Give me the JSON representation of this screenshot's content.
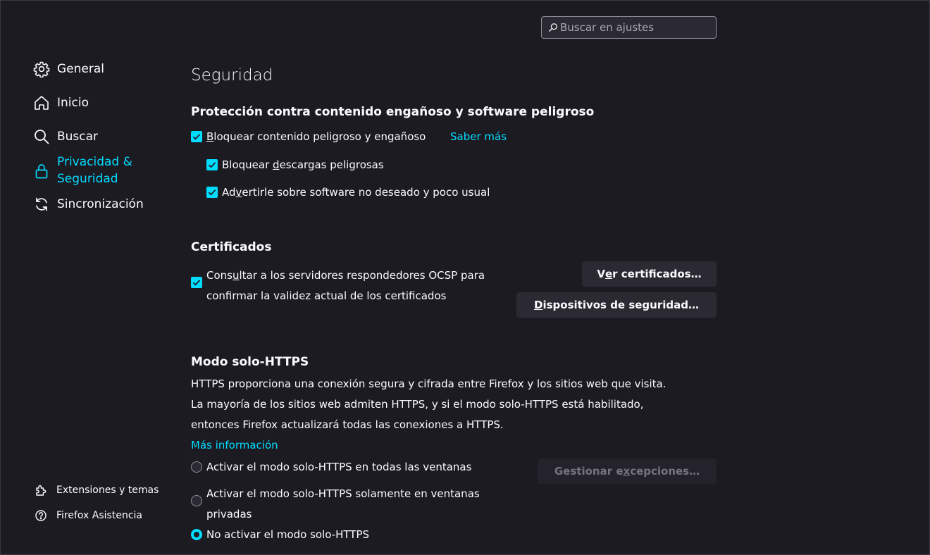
{
  "search": {
    "placeholder": "Buscar en ajustes"
  },
  "sidebar": {
    "items": [
      {
        "label": "General",
        "icon": "gear-icon"
      },
      {
        "label": "Inicio",
        "icon": "home-icon"
      },
      {
        "label": "Buscar",
        "icon": "search-icon"
      },
      {
        "label_line1": "Privacidad &",
        "label_line2": "Seguridad",
        "icon": "lock-icon",
        "active": true
      },
      {
        "label": "Sincronización",
        "icon": "sync-icon"
      }
    ],
    "footer": [
      {
        "label": "Extensiones y temas",
        "icon": "puzzle-icon"
      },
      {
        "label": "Firefox Asistencia",
        "icon": "help-icon"
      }
    ]
  },
  "page": {
    "title": "Seguridad"
  },
  "deceptive": {
    "heading": "Protección contra contenido engañoso y software peligroso",
    "block_pre": "",
    "block_key": "B",
    "block_post": "loquear contenido peligroso y engañoso",
    "learn_more": "Saber más",
    "downloads_pre": "Bloquear ",
    "downloads_key": "d",
    "downloads_post": "escargas peligrosas",
    "unwanted_pre": "Ad",
    "unwanted_key": "v",
    "unwanted_post": "ertirle sobre software no deseado y poco usual"
  },
  "certs": {
    "heading": "Certificados",
    "ocsp_line1_pre": "Cons",
    "ocsp_line1_key": "u",
    "ocsp_line1_post": "ltar a los servidores respondedores OCSP para",
    "ocsp_line2": "confirmar la validez actual de los certificados",
    "view_pre": "V",
    "view_key": "e",
    "view_post": "r certificados…",
    "devices_pre": "",
    "devices_key": "D",
    "devices_post": "ispositivos de seguridad…"
  },
  "https": {
    "heading": "Modo solo-HTTPS",
    "desc1": "HTTPS proporciona una conexión segura y cifrada entre Firefox y los sitios web que visita.",
    "desc2": "La mayoría de los sitios web admiten HTTPS, y si el modo solo-HTTPS está habilitado,",
    "desc3": "entonces Firefox actualizará todas las conexiones a HTTPS.",
    "more_info": "Más información",
    "opt_all": "Activar el modo solo-HTTPS en todas las ventanas",
    "opt_private_line1": "Activar el modo solo-HTTPS solamente en ventanas",
    "opt_private_line2": "privadas",
    "opt_off": "No activar el modo solo-HTTPS",
    "selected": "off",
    "exceptions_pre": "Gestionar e",
    "exceptions_key": "x",
    "exceptions_post": "cepciones…"
  },
  "colors": {
    "accent": "#00ddff",
    "background": "#1c1b22",
    "button": "#2b2a33"
  }
}
